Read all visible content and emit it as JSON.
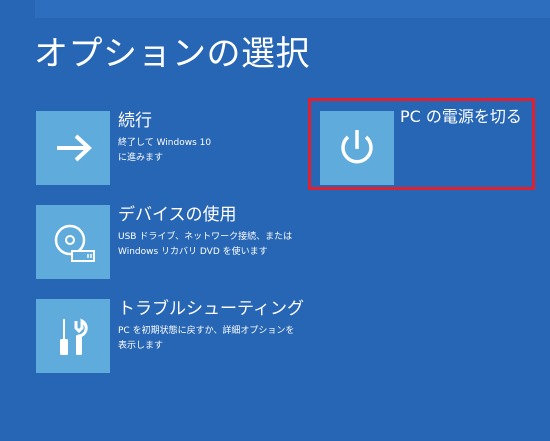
{
  "page_title": "オプションの選択",
  "options": [
    {
      "id": "continue",
      "icon": "arrow-right-icon",
      "title": "続行",
      "description": "終了して Windows 10\nに進みます"
    },
    {
      "id": "use-device",
      "icon": "disc-drive-icon",
      "title": "デバイスの使用",
      "description": "USB ドライブ、ネットワーク接続、または\nWindows リカバリ DVD を使います"
    },
    {
      "id": "troubleshoot",
      "icon": "tools-icon",
      "title": "トラブルシューティング",
      "description": "PC を初期状態に戻すか、詳細オプションを\n表示します"
    },
    {
      "id": "power-off",
      "icon": "power-icon",
      "title": "PC の電源を切る",
      "description": ""
    }
  ],
  "colors": {
    "background": "#2766b4",
    "tile": "#5fabdc",
    "highlight": "#e0202e",
    "text": "#ffffff"
  }
}
